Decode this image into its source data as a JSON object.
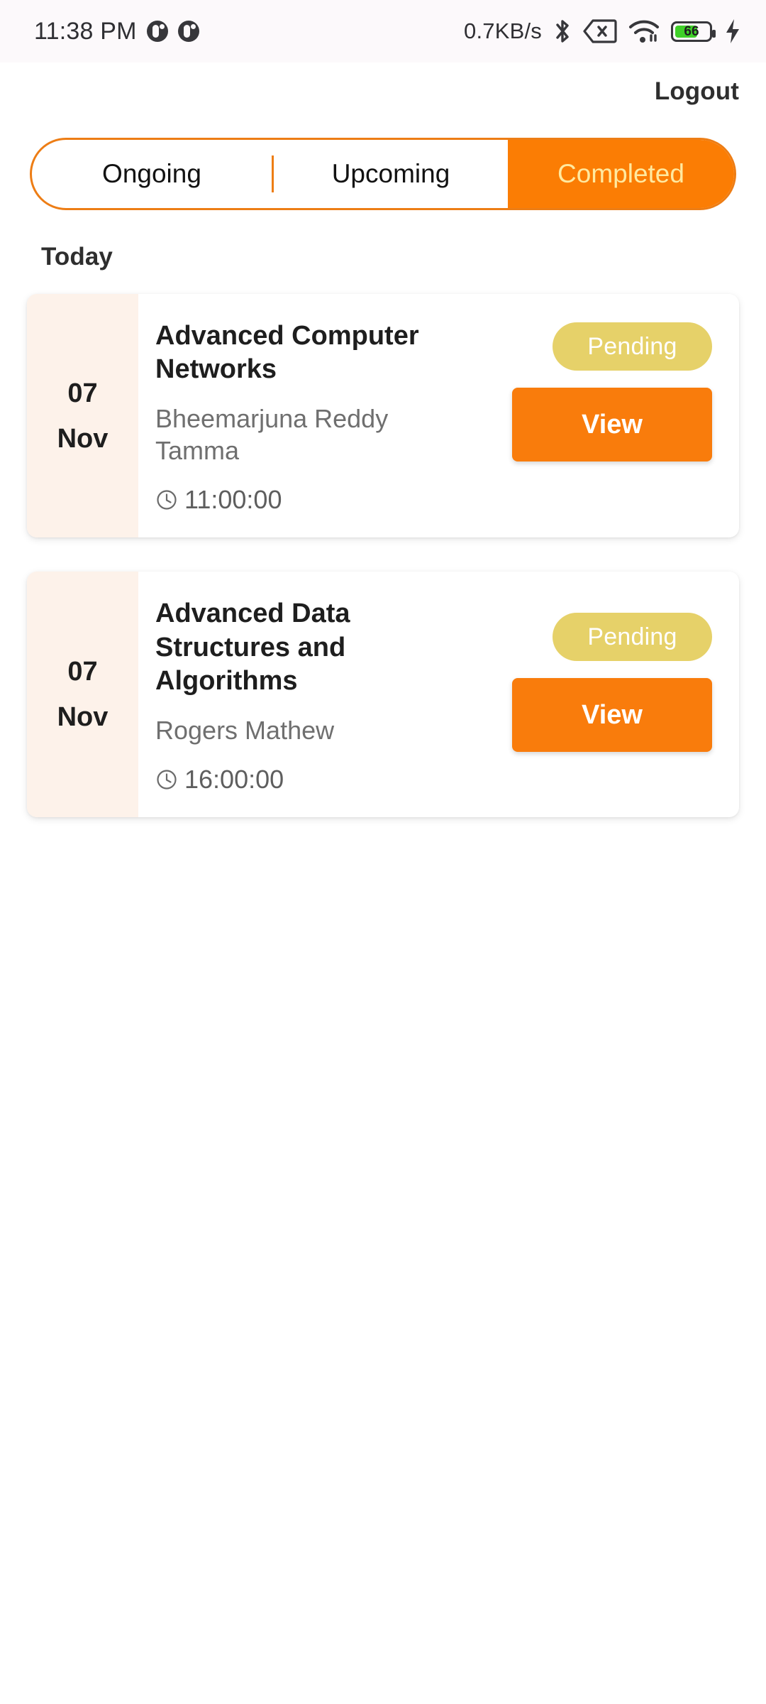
{
  "statusbar": {
    "time": "11:38 PM",
    "network_speed": "0.7KB/s",
    "battery_level": "66",
    "icons": [
      "notification-dot-icon",
      "notification-dot-icon",
      "bluetooth-icon",
      "sim-card-off-icon",
      "wifi-icon",
      "battery-icon",
      "charging-bolt-icon"
    ]
  },
  "header": {
    "logout_label": "Logout"
  },
  "tabs": {
    "items": [
      {
        "label": "Ongoing",
        "selected": false
      },
      {
        "label": "Upcoming",
        "selected": false
      },
      {
        "label": "Completed",
        "selected": true
      }
    ],
    "accent_color": "#ED7D15",
    "selected_bg": "#FB7D04",
    "selected_text_color": "#FFE9A0"
  },
  "section": {
    "title": "Today"
  },
  "cards": [
    {
      "day": "07",
      "month": "Nov",
      "title": "Advanced Computer Networks",
      "instructor": "Bheemarjuna Reddy Tamma",
      "time": "11:00:00",
      "status": "Pending",
      "action_label": "View"
    },
    {
      "day": "07",
      "month": "Nov",
      "title": "Advanced Data Structures and Algorithms",
      "instructor": "Rogers Mathew",
      "time": "16:00:00",
      "status": "Pending",
      "action_label": "View"
    }
  ],
  "colors": {
    "orange": "#F97C0C",
    "badge_pending": "#E6D169",
    "date_bg": "#FDF2EA",
    "page_bg": "#FFFFFF"
  }
}
